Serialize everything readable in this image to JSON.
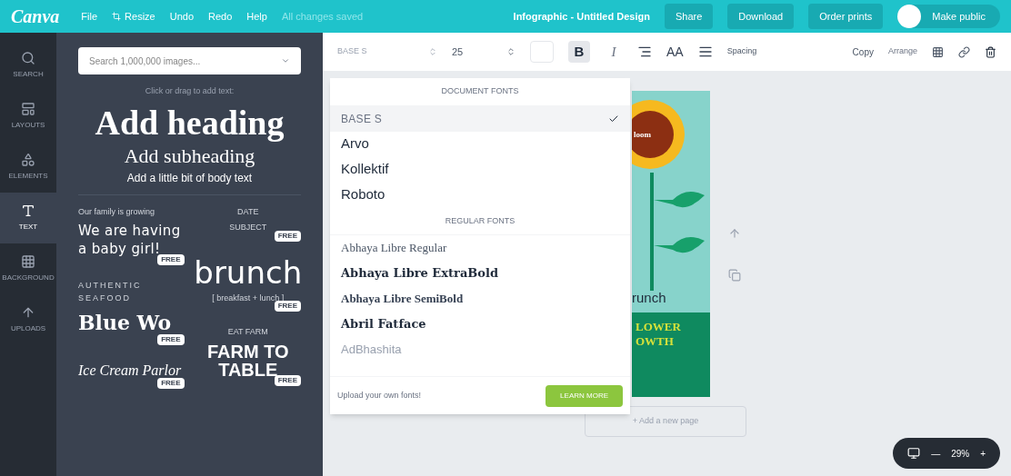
{
  "topbar": {
    "logo": "Canva",
    "menu": [
      {
        "label": "File",
        "kind": "plain"
      },
      {
        "label": "Resize",
        "kind": "resize"
      },
      {
        "label": "Undo",
        "kind": "plain"
      },
      {
        "label": "Redo",
        "kind": "plain"
      },
      {
        "label": "Help",
        "kind": "plain"
      }
    ],
    "status": "All changes saved",
    "title": "Infographic - Untitled Design",
    "buttons": [
      "Share",
      "Download",
      "Order prints"
    ],
    "publish": "Make public"
  },
  "rail": [
    {
      "label": "SEARCH",
      "kind": "search",
      "selected": false
    },
    {
      "label": "LAYOUTS",
      "kind": "layouts",
      "selected": false
    },
    {
      "label": "ELEMENTS",
      "kind": "elements",
      "selected": false
    },
    {
      "label": "TEXT",
      "kind": "text",
      "selected": true
    },
    {
      "label": "BACKGROUND",
      "kind": "background",
      "selected": false
    },
    {
      "label": "UPLOADS",
      "kind": "uploads",
      "selected": false
    }
  ],
  "panel": {
    "search": {
      "placeholder": "Search 1,000,000 images..."
    },
    "hint": "Click or drag to add text:",
    "heading": "Add heading",
    "subheading": "Add subheading",
    "body": "Add a little bit of body text",
    "columns": [
      [
        {
          "badge": "FREE",
          "lines": [
            {
              "text": "Our family is growing",
              "kind": "tiny"
            },
            {
              "text": "We are having a baby girl!",
              "kind": "hand"
            }
          ]
        },
        {
          "badge": "FREE",
          "lines": [
            {
              "text": "AUTHENTIC SEAFOOD",
              "kind": "caps"
            },
            {
              "text": "Blue Wo",
              "kind": "slab"
            }
          ]
        },
        {
          "badge": "FREE",
          "lines": [
            {
              "text": "Ice Cream Parlor",
              "kind": "script"
            }
          ]
        }
      ],
      [
        {
          "badge": "FREE",
          "lines": [
            {
              "text": "DATE",
              "kind": "tiny"
            },
            {
              "text": "SUBJECT",
              "kind": "tiny"
            }
          ]
        },
        {
          "badge": "FREE",
          "lines": [
            {
              "text": "brunch",
              "kind": "big"
            },
            {
              "text": "[ breakfast + lunch ]",
              "kind": "tiny"
            }
          ]
        },
        {
          "badge": "FREE",
          "lines": [
            {
              "text": "EAT FARM",
              "kind": "tiny"
            },
            {
              "text": "FARM TO TABLE",
              "kind": "block"
            }
          ]
        }
      ]
    ]
  },
  "toolbar": {
    "font": "BASE S",
    "size": "25",
    "bold_label": "B",
    "italic_label": "I",
    "bold": true,
    "italic": false,
    "case_label": "AA",
    "spacing": "Spacing",
    "copy": "Copy",
    "arrange": "Arrange"
  },
  "font_menu": {
    "sections": [
      {
        "title": "DOCUMENT FONTS",
        "fonts": [
          {
            "name": "BASE S",
            "kind": "caps",
            "selected": true
          },
          {
            "name": "Arvo",
            "kind": "sans",
            "selected": false
          },
          {
            "name": "Kollektif",
            "kind": "sans",
            "selected": false
          },
          {
            "name": "Roboto",
            "kind": "sans",
            "selected": false
          }
        ]
      },
      {
        "title": "REGULAR FONTS",
        "fonts": [
          {
            "name": "Abhaya Libre Regular",
            "kind": "serif",
            "selected": false
          },
          {
            "name": "Abhaya Libre ExtraBold",
            "kind": "serif-bold",
            "selected": false
          },
          {
            "name": "Abhaya Libre SemiBold",
            "kind": "serif-semi",
            "selected": false
          },
          {
            "name": "Abril Fatface",
            "kind": "serif-bold",
            "selected": false
          },
          {
            "name": "AdBhashita",
            "kind": "thin",
            "selected": false
          }
        ]
      }
    ],
    "upload": "Upload your own fonts!",
    "learn_more": "LEARN MORE"
  },
  "design": {
    "texts": [
      "loom",
      "runch",
      "LOWER",
      "OWTH"
    ]
  },
  "add_page": "+ Add a new page",
  "zoom": {
    "minus": "—",
    "value": "29%",
    "plus": "+"
  }
}
